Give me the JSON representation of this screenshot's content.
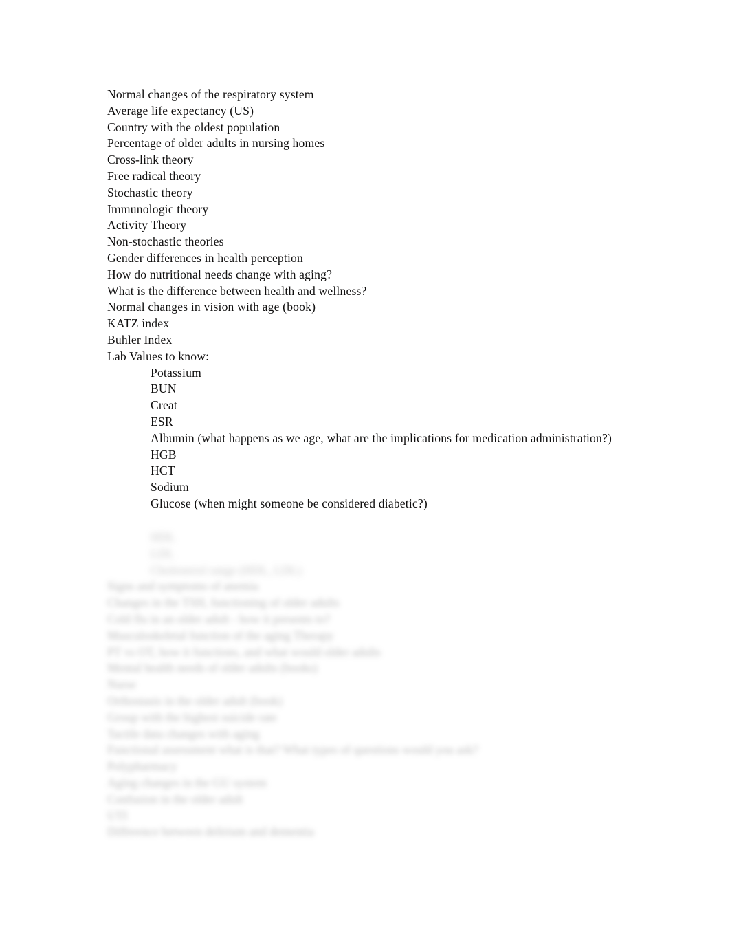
{
  "document": {
    "page_background": "#ffffff",
    "text_color": "#100f0f",
    "blurred_text_color": "#8d8d8d",
    "lines": [
      {
        "text": "Normal changes of the respiratory system",
        "indent": false
      },
      {
        "text": "Average life expectancy (US)",
        "indent": false
      },
      {
        "text": "Country with the oldest population",
        "indent": false
      },
      {
        "text": "Percentage of older adults in nursing homes",
        "indent": false
      },
      {
        "text": "Cross-link theory",
        "indent": false
      },
      {
        "text": "Free radical theory",
        "indent": false
      },
      {
        "text": "Stochastic theory",
        "indent": false
      },
      {
        "text": "Immunologic theory",
        "indent": false
      },
      {
        "text": "Activity Theory",
        "indent": false
      },
      {
        "text": "Non-stochastic theories",
        "indent": false
      },
      {
        "text": "Gender differences in health perception",
        "indent": false
      },
      {
        "text": "How do nutritional needs change with aging?",
        "indent": false
      },
      {
        "text": "What is the difference between health and wellness?",
        "indent": false
      },
      {
        "text": "Normal changes in vision with age (book)",
        "indent": false
      },
      {
        "text": "KATZ index",
        "indent": false
      },
      {
        "text": "Buhler Index",
        "indent": false
      },
      {
        "text": "Lab Values to know:",
        "indent": false
      },
      {
        "text": "Potassium",
        "indent": true
      },
      {
        "text": "BUN",
        "indent": true
      },
      {
        "text": "Creat",
        "indent": true
      },
      {
        "text": "ESR",
        "indent": true
      },
      {
        "text": "Albumin (what happens as we age, what are the implications for medication administration?)",
        "indent": true
      },
      {
        "text": "HGB",
        "indent": true
      },
      {
        "text": "HCT",
        "indent": true
      },
      {
        "text": "Sodium",
        "indent": true
      },
      {
        "text": "Glucose (when might someone be considered diabetic?)",
        "indent": true
      }
    ],
    "obscured_lines": [
      {
        "placeholder": "HDL",
        "indent": true,
        "soft": true
      },
      {
        "placeholder": "LDL",
        "indent": true,
        "soft": true
      },
      {
        "placeholder": "Cholesterol range (HDL, LDL)",
        "indent": true,
        "soft": true
      },
      {
        "placeholder": "Signs and symptoms of anemia",
        "indent": false,
        "soft": false
      },
      {
        "placeholder": "Changes in the TSH, functioning of older adults",
        "indent": false,
        "soft": false
      },
      {
        "placeholder": "Cold flu in an older adult - how it presents to?",
        "indent": false,
        "soft": false
      },
      {
        "placeholder": "Musculoskeletal function of the aging Therapy",
        "indent": false,
        "soft": false
      },
      {
        "placeholder": "PT vs OT, how it functions, and what would older adults",
        "indent": false,
        "soft": false
      },
      {
        "placeholder": "Mental health needs of older adults (books)",
        "indent": false,
        "soft": false
      },
      {
        "placeholder": "Nurse",
        "indent": false,
        "soft": false
      },
      {
        "placeholder": "Orthostasis in the older adult (book)",
        "indent": false,
        "soft": false
      },
      {
        "placeholder": "Group with the highest suicide rate",
        "indent": false,
        "soft": false
      },
      {
        "placeholder": "Tactile data changes with aging",
        "indent": false,
        "soft": false
      },
      {
        "placeholder": "Functional assessment what is that? What types of questions would you ask?",
        "indent": false,
        "soft": false
      },
      {
        "placeholder": "Polypharmacy",
        "indent": false,
        "soft": false
      },
      {
        "placeholder": "Aging changes in the GU system",
        "indent": false,
        "soft": false
      },
      {
        "placeholder": "Confusion in the older adult",
        "indent": false,
        "soft": false
      },
      {
        "placeholder": "UTI",
        "indent": false,
        "soft": false
      },
      {
        "placeholder": "Difference between delirium and dementia",
        "indent": false,
        "soft": false
      }
    ]
  }
}
